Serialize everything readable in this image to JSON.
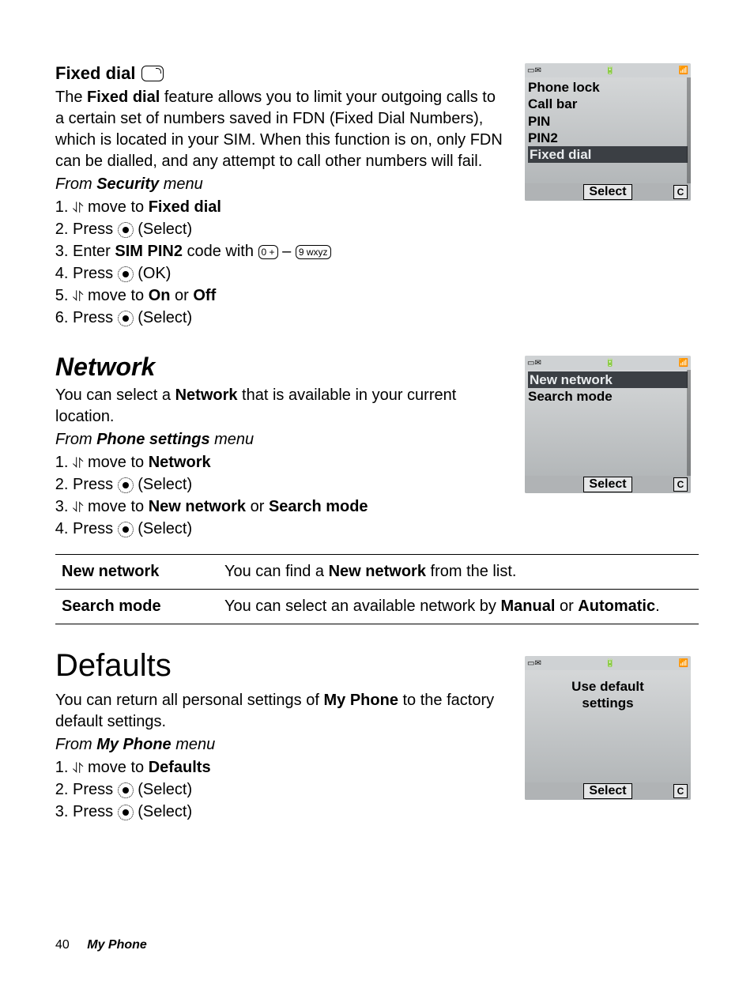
{
  "fixed_dial": {
    "heading": "Fixed dial",
    "para_pre": "The ",
    "para_b1": "Fixed dial",
    "para_post": " feature allows you to limit your outgoing calls to a certain set of numbers saved in FDN (Fixed Dial Numbers), which is located in your SIM. When this function is on, only FDN can be dialled, and any attempt to call other numbers will fail.",
    "from_pre": "From ",
    "from_b": "Security",
    "from_post": " menu",
    "s1_a": " move to ",
    "s1_b": "Fixed dial",
    "s2_a": "Press ",
    "s2_b": " (Select)",
    "s3_a": "Enter ",
    "s3_b": "SIM PIN2",
    "s3_c": " code with ",
    "s3_d": " – ",
    "s4_a": "Press ",
    "s4_b": " (OK)",
    "s5_a": " move to ",
    "s5_b": "On",
    "s5_c": " or ",
    "s5_d": "Off",
    "s6_a": "Press ",
    "s6_b": " (Select)",
    "key0": "0 +",
    "key9": "9 wxyz"
  },
  "network": {
    "heading": "Network",
    "para_a": "You can select a ",
    "para_b": "Network",
    "para_c": " that is available in your current location.",
    "from_pre": "From ",
    "from_b": "Phone settings",
    "from_post": " menu",
    "s1_a": " move to ",
    "s1_b": "Network",
    "s2_a": "Press ",
    "s2_b": " (Select)",
    "s3_a": " move to ",
    "s3_b": "New network",
    "s3_c": " or ",
    "s3_d": "Search mode",
    "s4_a": "Press ",
    "s4_b": " (Select)"
  },
  "table": {
    "r1k": "New network",
    "r1a": "You can find a ",
    "r1b": "New network",
    "r1c": " from the list.",
    "r2k": "Search mode",
    "r2a": "You can select an available network by ",
    "r2b": "Manual",
    "r2c": " or ",
    "r2d": "Automatic",
    "r2e": "."
  },
  "defaults": {
    "heading": "Defaults",
    "para_a": "You can return all personal settings of ",
    "para_b": "My Phone",
    "para_c": " to the factory default settings.",
    "from_pre": "From ",
    "from_b": "My Phone",
    "from_post": " menu",
    "s1_a": " move to ",
    "s1_b": "Defaults",
    "s2_a": "Press ",
    "s2_b": " (Select)",
    "s3_a": "Press ",
    "s3_b": " (Select)"
  },
  "shots": {
    "select": "Select",
    "c": "C",
    "s1": {
      "l1": "Phone lock",
      "l2": "Call bar",
      "l3": "PIN",
      "l4": "PIN2",
      "l5": "Fixed dial"
    },
    "s2": {
      "l1": "New network",
      "l2": "Search mode"
    },
    "s3": {
      "l1": "Use default",
      "l2": "settings"
    }
  },
  "footer": {
    "page": "40",
    "chapter": "My Phone"
  }
}
